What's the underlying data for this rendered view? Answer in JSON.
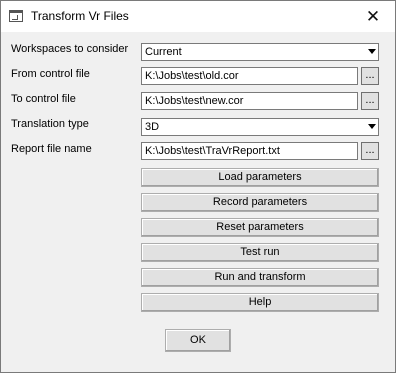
{
  "window": {
    "title": "Transform Vr Files",
    "app_icon": "window-icon",
    "close_glyph": "✕"
  },
  "form": {
    "workspaces": {
      "label": "Workspaces to consider",
      "value": "Current"
    },
    "from_control": {
      "label": "From control file",
      "value": "K:\\Jobs\\test\\old.cor",
      "browse": "..."
    },
    "to_control": {
      "label": "To control file",
      "value": "K:\\Jobs\\test\\new.cor",
      "browse": "..."
    },
    "translation": {
      "label": "Translation type",
      "value": "3D"
    },
    "report": {
      "label": "Report file name",
      "value": "K:\\Jobs\\test\\TraVrReport.txt",
      "browse": "..."
    }
  },
  "buttons": {
    "load": "Load parameters",
    "record": "Record parameters",
    "reset": "Reset parameters",
    "test": "Test run",
    "run": "Run and transform",
    "help": "Help",
    "ok": "OK"
  }
}
